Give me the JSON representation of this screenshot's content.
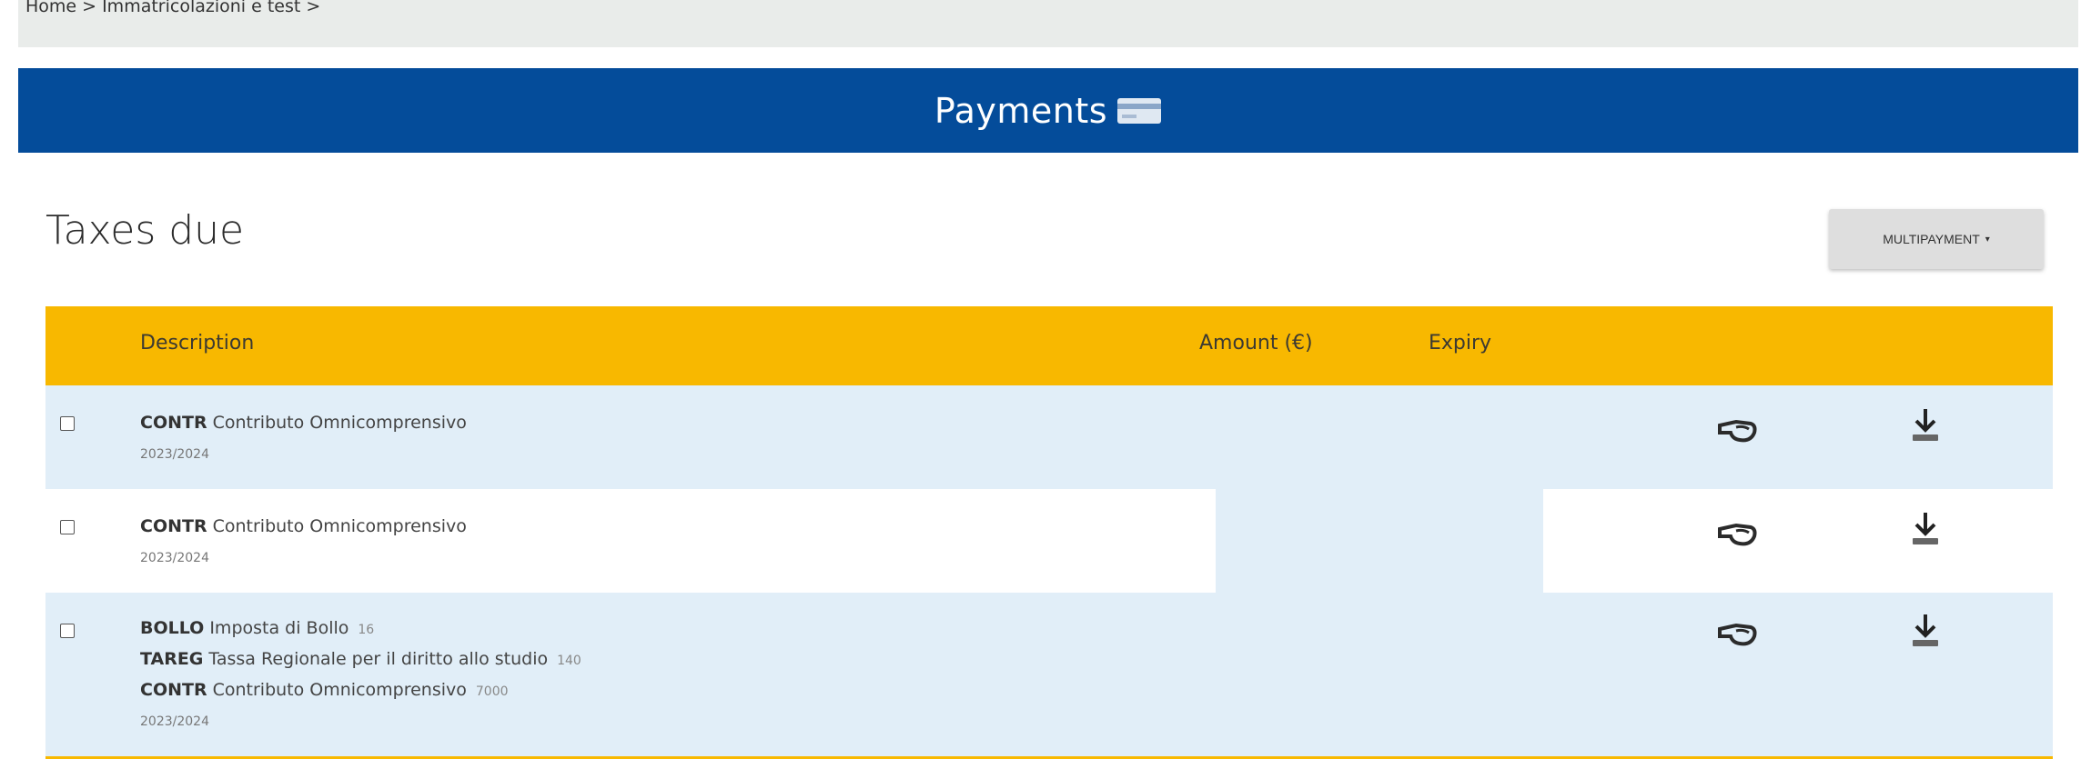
{
  "breadcrumb": {
    "home": "Home >",
    "section": "Immatricolazioni e test >"
  },
  "header": {
    "title": "Payments",
    "icon": "credit-card-icon"
  },
  "main": {
    "title": "Taxes due",
    "multipayment_label": "MULTIPAYMENT"
  },
  "table": {
    "columns": {
      "description": "Description",
      "amount": "Amount (€)",
      "expiry": "Expiry"
    },
    "rows": [
      {
        "items": [
          {
            "code": "CONTR",
            "name": "Contributo Omnicomprensivo",
            "amount": ""
          }
        ],
        "year": "2023/2024"
      },
      {
        "items": [
          {
            "code": "CONTR",
            "name": "Contributo Omnicomprensivo",
            "amount": ""
          }
        ],
        "year": "2023/2024"
      },
      {
        "items": [
          {
            "code": "BOLLO",
            "name": "Imposta di Bollo",
            "amount": "16"
          },
          {
            "code": "TAREG",
            "name": "Tassa Regionale per il diritto allo studio",
            "amount": "140"
          },
          {
            "code": "CONTR",
            "name": "Contributo Omnicomprensivo",
            "amount": "7000"
          }
        ],
        "year": "2023/2024"
      }
    ],
    "action_icons": [
      "pay-hand-icon",
      "download-icon"
    ]
  },
  "colors": {
    "header_blue": "#044c9a",
    "table_header_yellow": "#f8b800",
    "row_blue": "#e1eef8"
  }
}
